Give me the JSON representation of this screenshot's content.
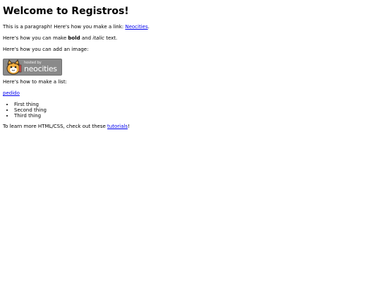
{
  "page": {
    "title": "Welcome to Registros!",
    "p1": {
      "text": "This is a paragraph! Here's how you make a link: ",
      "link": "Neocities",
      "end": "."
    },
    "p2": {
      "pre": "Here's how you can make ",
      "bold": "bold",
      "mid": " and ",
      "italic": "italic",
      "end": " text."
    },
    "p3": "Here's how you can add an image:",
    "badge": {
      "top": "hosted by",
      "brand": "neocities"
    },
    "p4": "Here's how to make a list:",
    "pedido": "pedido",
    "list": [
      "First thing",
      "Second thing",
      "Third thing"
    ],
    "p5": {
      "text": "To learn more HTML/CSS, check out these ",
      "link": "tutorials",
      "end": "!"
    }
  },
  "colors": {
    "link": "#0000ee",
    "badge_bg": "#8a8a8a"
  },
  "icons": {
    "badge": "neocities-cat-icon"
  }
}
